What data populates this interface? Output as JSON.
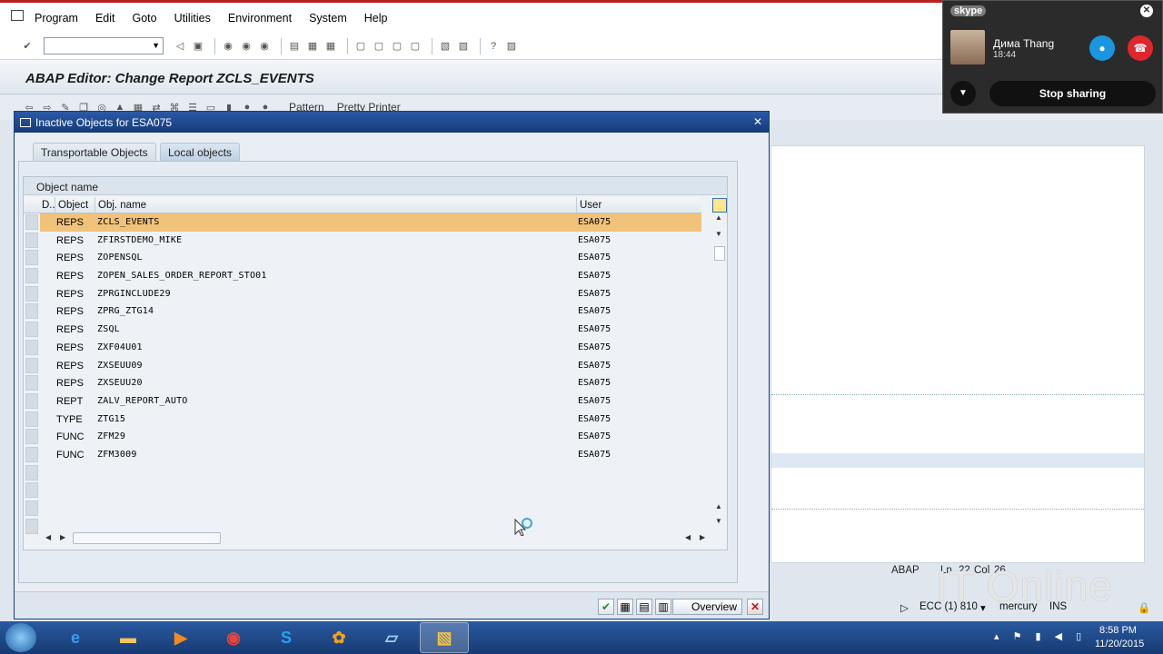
{
  "menu": {
    "items": [
      "Program",
      "Edit",
      "Goto",
      "Utilities",
      "Environment",
      "System",
      "Help"
    ]
  },
  "window": {
    "title": "ABAP Editor: Change Report ZCLS_EVENTS"
  },
  "app_toolbar": {
    "pattern_label": "Pattern",
    "pretty_printer_label": "Pretty Printer"
  },
  "dialog": {
    "title": "Inactive Objects for ESA075",
    "tabs": [
      {
        "label": "Transportable Objects",
        "active": false
      },
      {
        "label": "Local objects",
        "active": true
      }
    ],
    "grid": {
      "caption": "Object name",
      "columns": [
        "D..",
        "Object",
        "Obj. name",
        "User"
      ],
      "rows": [
        {
          "object": "REPS",
          "name": "ZCLS_EVENTS",
          "user": "ESA075",
          "selected": true
        },
        {
          "object": "REPS",
          "name": "ZFIRSTDEMO_MIKE",
          "user": "ESA075"
        },
        {
          "object": "REPS",
          "name": "ZOPENSQL",
          "user": "ESA075"
        },
        {
          "object": "REPS",
          "name": "ZOPEN_SALES_ORDER_REPORT_STO01",
          "user": "ESA075"
        },
        {
          "object": "REPS",
          "name": "ZPRGINCLUDE29",
          "user": "ESA075"
        },
        {
          "object": "REPS",
          "name": "ZPRG_ZTG14",
          "user": "ESA075"
        },
        {
          "object": "REPS",
          "name": "ZSQL",
          "user": "ESA075"
        },
        {
          "object": "REPS",
          "name": "ZXF04U01",
          "user": "ESA075"
        },
        {
          "object": "REPS",
          "name": "ZXSEUU09",
          "user": "ESA075"
        },
        {
          "object": "REPS",
          "name": "ZXSEUU20",
          "user": "ESA075"
        },
        {
          "object": "REPT",
          "name": "ZALV_REPORT_AUTO",
          "user": "ESA075"
        },
        {
          "object": "TYPE",
          "name": "ZTG15",
          "user": "ESA075"
        },
        {
          "object": "FUNC",
          "name": "ZFM29",
          "user": "ESA075"
        },
        {
          "object": "FUNC",
          "name": "ZFM3009",
          "user": "ESA075"
        }
      ]
    },
    "footer": {
      "overview_label": "Overview"
    }
  },
  "editor_status": {
    "mode": "ABAP",
    "ln_label": "Ln",
    "ln_value": "22",
    "col_label": "Col",
    "col_value": "26"
  },
  "status_bar": {
    "system": "ECC (1) 810",
    "server": "mercury",
    "insert_mode": "INS"
  },
  "skype": {
    "brand": "skype",
    "contact_name": "Дима Thang",
    "call_duration": "18:44",
    "stop_sharing_label": "Stop sharing"
  },
  "watermark": "IT Online",
  "taskbar": {
    "time": "8:58 PM",
    "date": "11/20/2015"
  },
  "colors": {
    "selection_row": "#f0c27a",
    "dialog_title": "#1f4a8f",
    "menubar_top_border": "#b92121",
    "skype_mic": "#1a95df",
    "skype_hangup": "#e0262d"
  }
}
